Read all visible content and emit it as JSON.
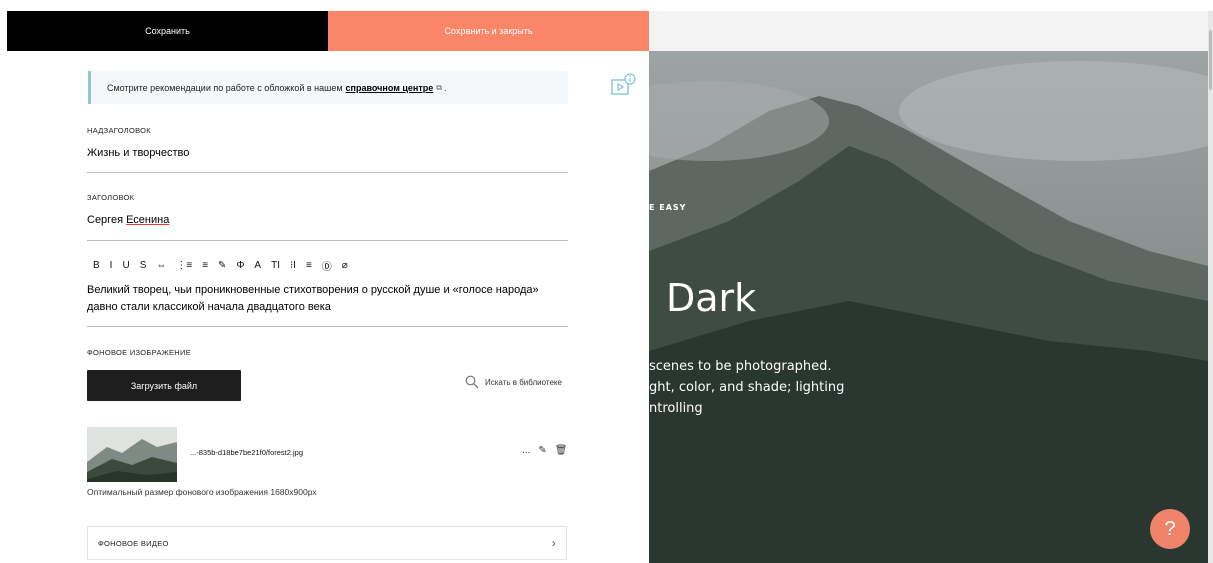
{
  "header": {
    "save_label": "Сохранить",
    "save_close_label": "Сохранить и закрыть"
  },
  "hint": {
    "text": "Смотрите рекомендации по работе с обложкой в нашем",
    "link": "справочном центре",
    "icon": "external-link-icon",
    "end": "."
  },
  "fields": {
    "supertitle": {
      "label": "НАДЗАГОЛОВОК",
      "value": "Жизнь и творчество"
    },
    "title": {
      "label": "ЗАГОЛОВОК",
      "value_prefix": "Сергея ",
      "value_link": "Есенина"
    },
    "description": "Великий творец, чьи проникновенные стихотворения о русской душе и «голосе народа» давно стали классикой начала двадцатого века"
  },
  "toolbar": [
    "B",
    "I",
    "U",
    "S",
    "⇔",
    "⋮≡",
    "≡",
    "✎",
    "Φ",
    "A",
    "TI",
    "⁝I",
    "≡",
    "Ⓓ",
    "⌀"
  ],
  "background": {
    "label": "ФОНОВОЕ ИЗОБРАЖЕНИЕ",
    "upload_label": "Загрузить файл",
    "search_label": "Искать в библиотеке",
    "filename": "...-835b-d18be7be21f0/forest2.jpg",
    "more": "...",
    "size_hint": "Оптимальный размер фонового изображения 1680x900px"
  },
  "video": {
    "label": "ФОНОВОЕ ВИДЕО",
    "chevron": "›"
  },
  "preview": {
    "small_caps": "E EASY",
    "heading": "Dark",
    "lines": [
      "scenes to be photographed.",
      "ght, color, and shade; lighting",
      "ntrolling"
    ]
  },
  "help": {
    "label": "?"
  },
  "colors": {
    "accent": "#fa8669",
    "help": "#f0846a"
  }
}
